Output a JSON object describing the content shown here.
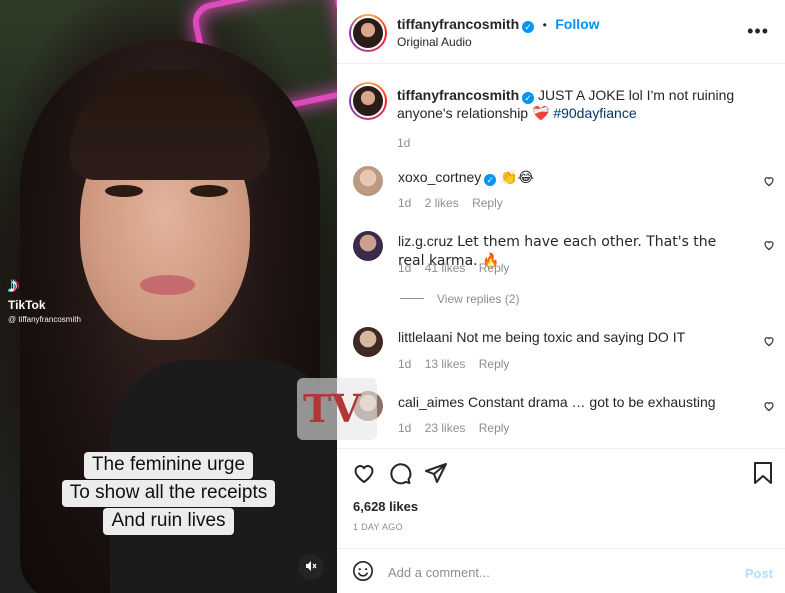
{
  "post": {
    "author": "tiffanyfrancosmith",
    "audio": "Original Audio",
    "follow_label": "Follow",
    "dot": "•",
    "more": "•••",
    "caption": "JUST A JOKE lol I'm not ruining anyone's relationship",
    "caption_heart": "❤️‍🩹",
    "hashtag": "#90dayfiance",
    "time": "1d",
    "likes": "6,628 likes",
    "date": "1 DAY AGO"
  },
  "media": {
    "tiktok_logo": "♪",
    "tiktok_brand": "TikTok",
    "tiktok_handle": "@ tiffanyfrancosmith",
    "caption_lines": [
      "The feminine urge",
      "To show all the receipts",
      "And ruin lives"
    ],
    "watermark": "TV",
    "mute_icon": "mute-icon"
  },
  "comments": [
    {
      "user": "xoxo_cortney",
      "verified": true,
      "text": "👏😂",
      "time": "1d",
      "likes": "2 likes",
      "reply": "Reply"
    },
    {
      "user": "liz.g.cruz",
      "verified": false,
      "text": "Let them have each other. That's the real karma. 🔥",
      "time": "1d",
      "likes": "41 likes",
      "reply": "Reply",
      "view_replies": "View replies (2)"
    },
    {
      "user": "littlelaani",
      "verified": false,
      "text": "Not me being toxic and saying DO IT",
      "time": "1d",
      "likes": "13 likes",
      "reply": "Reply"
    },
    {
      "user": "cali_aimes",
      "verified": false,
      "text": "Constant drama … got to be exhausting",
      "time": "1d",
      "likes": "23 likes",
      "reply": "Reply"
    }
  ],
  "comment_box": {
    "placeholder": "Add a comment...",
    "post_label": "Post"
  },
  "colors": {
    "accent": "#0095f6",
    "muted": "#8e8e8e",
    "post_disabled": "#b2dffc"
  }
}
